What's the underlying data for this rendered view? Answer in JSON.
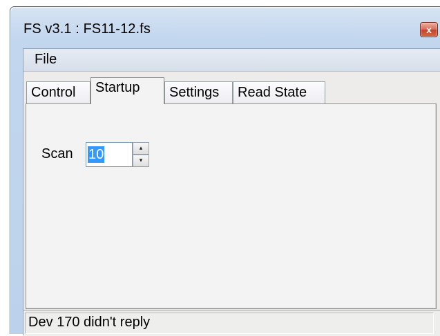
{
  "window": {
    "title": "FS v3.1 : FS11-12.fs",
    "close_glyph": "x"
  },
  "menu": {
    "items": [
      {
        "label": "File"
      }
    ]
  },
  "tabs": [
    {
      "label": "Control",
      "selected": false
    },
    {
      "label": "Startup",
      "selected": true
    },
    {
      "label": "Settings",
      "selected": false
    },
    {
      "label": "Read State",
      "selected": false
    }
  ],
  "startup": {
    "scan_label": "Scan",
    "scan_value": "10",
    "spin_up_icon": "triangle-up",
    "spin_down_icon": "triangle-down"
  },
  "status": {
    "text": "Dev 170 didn't reply"
  },
  "colors": {
    "frame": "#c2d6ee",
    "close_button": "#c4432b",
    "selection": "#3399ff"
  }
}
